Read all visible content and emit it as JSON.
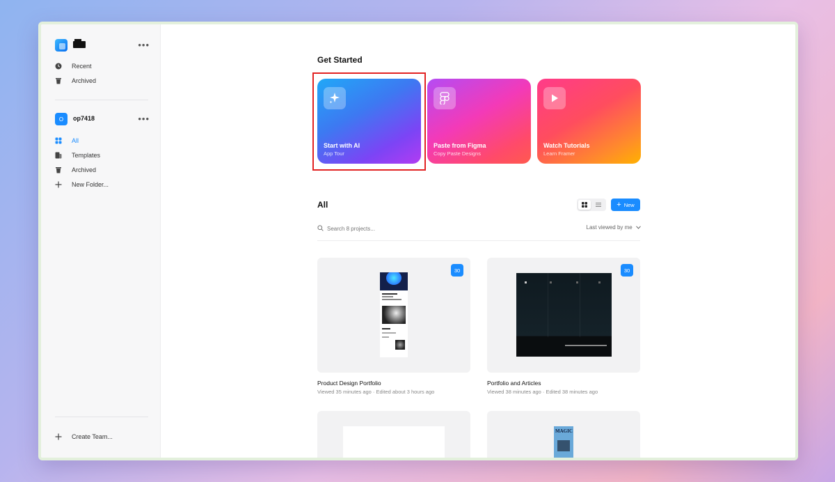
{
  "sidebar": {
    "top_menu_icon": "more-horizontal-icon",
    "personal_items": [
      {
        "label": "Recent",
        "icon": "clock-icon"
      },
      {
        "label": "Archived",
        "icon": "trash-icon"
      }
    ],
    "team": {
      "badge": "O",
      "name": "op7418"
    },
    "team_items": [
      {
        "label": "All",
        "icon": "grid-icon",
        "active": true
      },
      {
        "label": "Templates",
        "icon": "templates-icon"
      },
      {
        "label": "Archived",
        "icon": "trash-icon"
      },
      {
        "label": "New Folder...",
        "icon": "plus-icon"
      }
    ],
    "create_team": "Create Team..."
  },
  "main": {
    "get_started_title": "Get Started",
    "cards": [
      {
        "title": "Start with AI",
        "subtitle": "App Tour",
        "icon": "sparkles-icon"
      },
      {
        "title": "Paste from Figma",
        "subtitle": "Copy Paste Designs",
        "icon": "figma-icon"
      },
      {
        "title": "Watch Tutorials",
        "subtitle": "Learn Framer",
        "icon": "play-icon"
      }
    ],
    "all_title": "All",
    "new_button": "New",
    "search_placeholder": "Search 8 projects...",
    "sort_label": "Last viewed by me",
    "projects": [
      {
        "name": "Product Design Portfolio",
        "meta": "Viewed 35 minutes ago · Edited about 3 hours ago",
        "badge": "30"
      },
      {
        "name": "Portfolio and Articles",
        "meta": "Viewed 38 minutes ago · Edited 38 minutes ago",
        "badge": "30"
      },
      {
        "name": "",
        "meta": "",
        "badge": ""
      },
      {
        "name": "",
        "meta": "",
        "badge": "",
        "thumb_text": "MAGIC"
      }
    ]
  },
  "colors": {
    "accent": "#1a8cff",
    "highlight": "#e22222"
  }
}
